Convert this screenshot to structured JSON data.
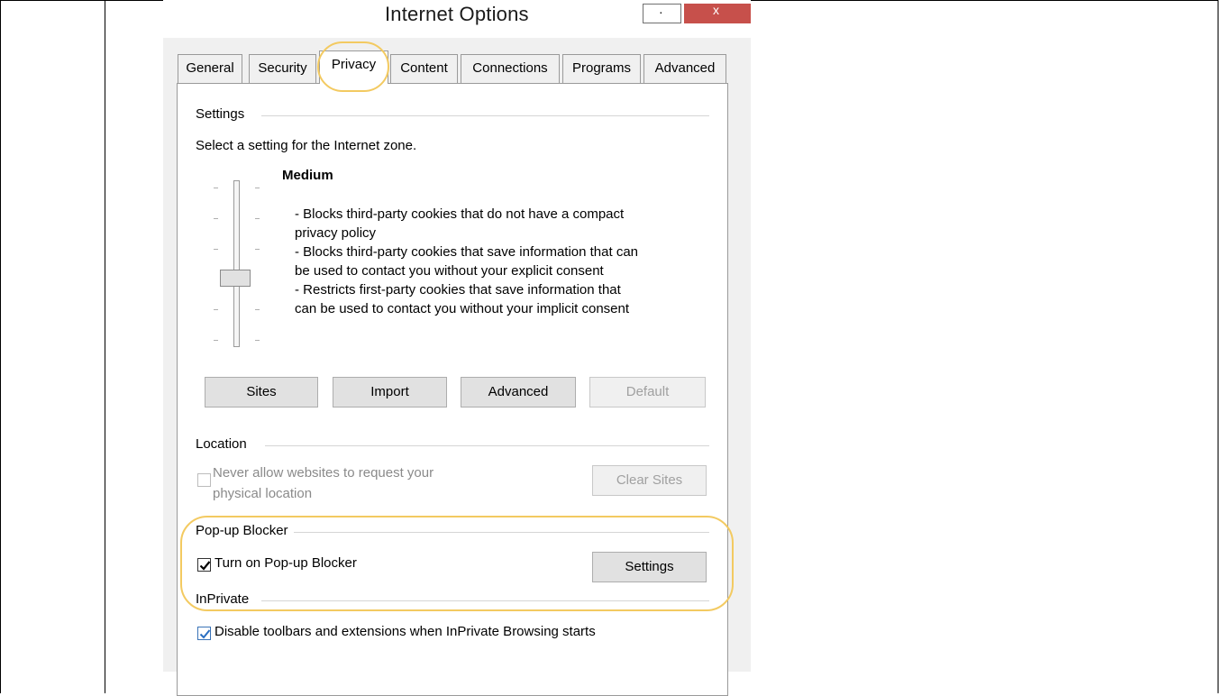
{
  "dialog": {
    "title": "Internet Options",
    "minimize_glyph": "·",
    "close_glyph": "x"
  },
  "tabs": [
    {
      "label": "General"
    },
    {
      "label": "Security"
    },
    {
      "label": "Privacy",
      "active": true
    },
    {
      "label": "Content"
    },
    {
      "label": "Connections"
    },
    {
      "label": "Programs"
    },
    {
      "label": "Advanced"
    }
  ],
  "settings": {
    "group_label": "Settings",
    "instruction": "Select a setting for the Internet zone.",
    "level": "Medium",
    "slider_level_index": 3,
    "slider_level_count": 6,
    "description": [
      " - Blocks third-party cookies that do not have a compact",
      "privacy policy",
      " - Blocks third-party cookies that save information that can",
      "be used to contact you without your explicit consent",
      " - Restricts first-party cookies that save information that",
      "can be used to contact you without your implicit consent"
    ],
    "buttons": {
      "sites": "Sites",
      "import": "Import",
      "advanced": "Advanced",
      "default": "Default"
    }
  },
  "location": {
    "group_label": "Location",
    "checkbox_label_line1": "Never allow websites to request your",
    "checkbox_label_line2": "physical location",
    "checked": false,
    "clear_sites": "Clear Sites"
  },
  "popup_blocker": {
    "group_label": "Pop-up Blocker",
    "checkbox_label": "Turn on Pop-up Blocker",
    "checked": true,
    "settings_button": "Settings"
  },
  "inprivate": {
    "group_label": "InPrivate",
    "checkbox_label": "Disable toolbars and extensions when InPrivate Browsing starts",
    "checked": true
  },
  "colors": {
    "highlight": "#f3ca61",
    "close_button": "#c7504b",
    "checkbox_blue": "#3a73b7"
  }
}
